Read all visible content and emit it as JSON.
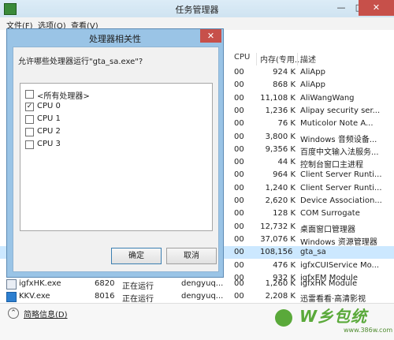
{
  "window": {
    "title": "任务管理器",
    "minimize": "—",
    "maximize": "□",
    "close": "✕"
  },
  "menu": [
    "文件(F)",
    "选项(O)",
    "查看(V)"
  ],
  "columns": {
    "cpu": "CPU",
    "memory": "内存(专用...",
    "description": "描述"
  },
  "processes": [
    {
      "cpu": "00",
      "memory": "924 K",
      "description": "AliApp"
    },
    {
      "cpu": "00",
      "memory": "868 K",
      "description": "AliApp"
    },
    {
      "cpu": "00",
      "memory": "11,108 K",
      "description": "AliWangWang"
    },
    {
      "cpu": "00",
      "memory": "1,236 K",
      "description": "Alipay security ser..."
    },
    {
      "cpu": "00",
      "memory": "76 K",
      "description": "Muticolor Note A..."
    },
    {
      "cpu": "00",
      "memory": "3,800 K",
      "description": "Windows 音频设备..."
    },
    {
      "cpu": "00",
      "memory": "9,356 K",
      "description": "百度中文输入法服务..."
    },
    {
      "cpu": "00",
      "memory": "44 K",
      "description": "控制台窗口主进程"
    },
    {
      "cpu": "00",
      "memory": "964 K",
      "description": "Client Server Runti..."
    },
    {
      "cpu": "00",
      "memory": "1,240 K",
      "description": "Client Server Runti..."
    },
    {
      "cpu": "00",
      "memory": "2,620 K",
      "description": "Device Association..."
    },
    {
      "cpu": "00",
      "memory": "128 K",
      "description": "COM Surrogate"
    },
    {
      "cpu": "00",
      "memory": "12,732 K",
      "description": "桌面窗口管理器"
    },
    {
      "cpu": "00",
      "memory": "37,076 K",
      "description": "Windows 资源管理器"
    },
    {
      "cpu": "00",
      "memory": "108,156 K",
      "description": "gta_sa"
    },
    {
      "cpu": "00",
      "memory": "476 K",
      "description": "igfxCUIService Mo..."
    },
    {
      "cpu": "00",
      "memory": "932 K",
      "description": "igfxEM Module"
    }
  ],
  "full_rows": [
    {
      "name": "igfxHK.exe",
      "pid": "6820",
      "status": "正在运行",
      "user": "dengyuq...",
      "cpu": "00",
      "memory": "1,260 K",
      "description": "igfxHK Module"
    },
    {
      "name": "KKV.exe",
      "pid": "8016",
      "status": "正在运行",
      "user": "dengyuq...",
      "cpu": "00",
      "memory": "2,208 K",
      "description": "迅雷看看·高清影视"
    }
  ],
  "footer": {
    "chevron": "⌃",
    "fewer_details": "简略信息(D)"
  },
  "dialog": {
    "title": "处理器相关性",
    "close": "✕",
    "prompt": "允许哪些处理器运行\"gta_sa.exe\"?",
    "options": [
      {
        "label": "<所有处理器>",
        "checked": ""
      },
      {
        "label": "CPU 0",
        "checked": "✓"
      },
      {
        "label": "CPU 1",
        "checked": ""
      },
      {
        "label": "CPU 2",
        "checked": ""
      },
      {
        "label": "CPU 3",
        "checked": ""
      }
    ],
    "ok": "确定",
    "cancel": "取消"
  },
  "watermark": {
    "text": "W乡包统",
    "url": "www.386w.com"
  }
}
